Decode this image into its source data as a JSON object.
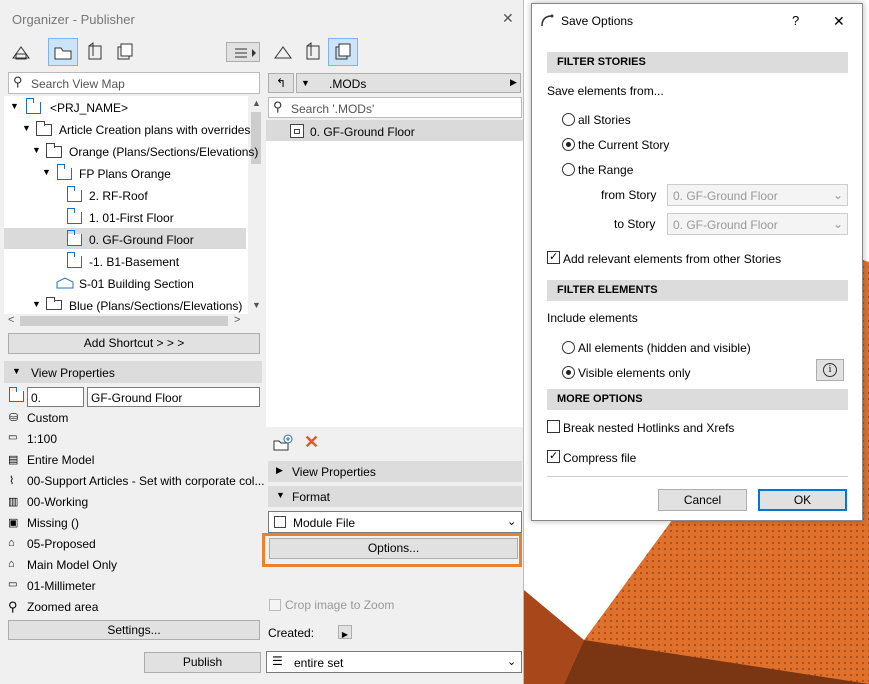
{
  "organizer": {
    "title": "Organizer - Publisher",
    "search_placeholder": "Search View Map",
    "tree": [
      {
        "label": "<PRJ_NAME>"
      },
      {
        "label": "Article Creation plans with overrides"
      },
      {
        "label": "Orange (Plans/Sections/Elevations)"
      },
      {
        "label": "FP Plans Orange"
      },
      {
        "label": "2. RF-Roof"
      },
      {
        "label": "1. 01-First Floor"
      },
      {
        "label": "0. GF-Ground Floor"
      },
      {
        "label": "-1. B1-Basement"
      },
      {
        "label": "S-01 Building Section"
      },
      {
        "label": "Blue (Plans/Sections/Elevations)"
      }
    ],
    "add_shortcut": "Add Shortcut > > >",
    "view_properties_header": "View Properties",
    "vp_id": "0.",
    "vp_name": "GF-Ground Floor",
    "vp_items": [
      {
        "label": "Custom"
      },
      {
        "label": "1:100"
      },
      {
        "label": "Entire Model"
      },
      {
        "label": "00-Support Articles - Set with corporate col..."
      },
      {
        "label": "00-Working"
      },
      {
        "label": "Missing ()"
      },
      {
        "label": "05-Proposed"
      },
      {
        "label": "Main Model Only"
      },
      {
        "label": "01-Millimeter"
      },
      {
        "label": "Zoomed area"
      }
    ],
    "settings": "Settings...",
    "publish": "Publish"
  },
  "publisher": {
    "folder": ".MODs",
    "search_placeholder": "Search '.MODs'",
    "item": "0. GF-Ground Floor",
    "view_properties": "View Properties",
    "format": "Format",
    "format_value": "Module File",
    "options": "Options...",
    "crop": "Crop image to Zoom",
    "created": "Created:",
    "entire_set": "entire set"
  },
  "dialog": {
    "title": "Save Options",
    "help": "?",
    "close": "✕",
    "filter_stories": "FILTER STORIES",
    "save_from": "Save elements from...",
    "all_stories": "all Stories",
    "current_story": "the Current Story",
    "range": "the Range",
    "from_story": "from Story",
    "to_story": "to Story",
    "from_value": "0. GF-Ground Floor",
    "to_value": "0. GF-Ground Floor",
    "add_relevant": "Add relevant elements from other Stories",
    "filter_elements": "FILTER ELEMENTS",
    "include": "Include elements",
    "all_elements": "All elements (hidden and visible)",
    "visible_only": "Visible elements only",
    "more_options": "MORE OPTIONS",
    "break_nested": "Break nested Hotlinks and Xrefs",
    "compress": "Compress file",
    "cancel": "Cancel",
    "ok": "OK"
  },
  "colors": {
    "accent": "#e8822d",
    "box": "#c8551a",
    "selection": "#cce4f7"
  }
}
